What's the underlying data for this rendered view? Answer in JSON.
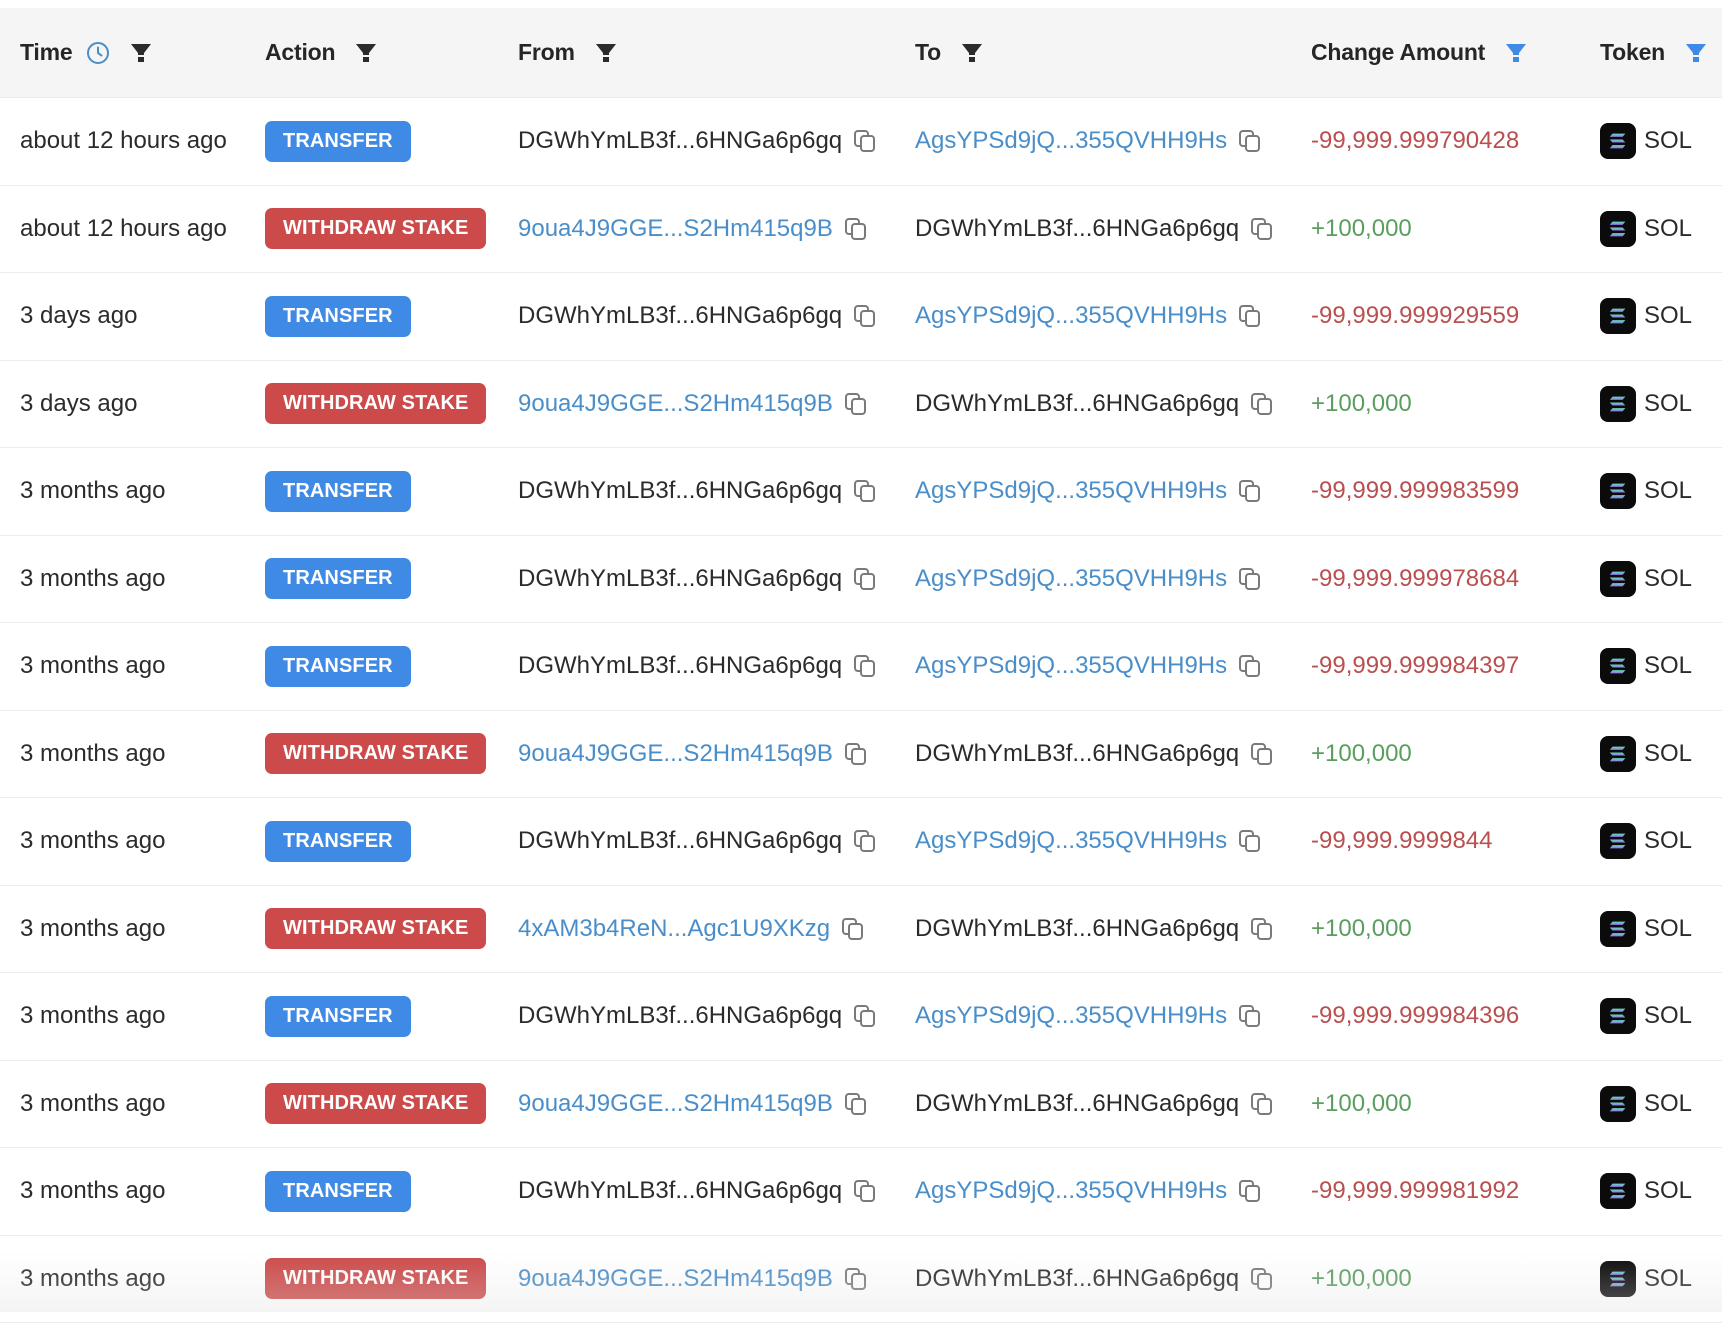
{
  "header": {
    "columns": [
      {
        "label": "Time",
        "icons": [
          "clock-icon",
          "filter-icon"
        ],
        "filter_active": false
      },
      {
        "label": "Action",
        "icons": [
          "filter-icon"
        ],
        "filter_active": false
      },
      {
        "label": "From",
        "icons": [
          "filter-icon"
        ],
        "filter_active": false
      },
      {
        "label": "To",
        "icons": [
          "filter-icon"
        ],
        "filter_active": false
      },
      {
        "label": "Change Amount",
        "icons": [
          "filter-icon"
        ],
        "filter_active": true
      },
      {
        "label": "Token",
        "icons": [
          "filter-icon"
        ],
        "filter_active": true
      }
    ]
  },
  "colors": {
    "transfer_badge": "#3f8ae5",
    "withdraw_badge": "#cc4a4a",
    "link": "#4a8ec9",
    "negative": "#b94f4f",
    "positive": "#5a9e5e",
    "filter_inactive": "#2b2b2b",
    "filter_active": "#3f8ae5",
    "clock": "#4a8ec9"
  },
  "rows": [
    {
      "time": "about 12 hours ago",
      "action": "TRANSFER",
      "action_type": "transfer",
      "from": "DGWhYmLB3f...6HNGa6p6gq",
      "from_link": false,
      "to": "AgsYPSd9jQ...355QVHH9Hs",
      "to_link": true,
      "amount": "-99,999.999790428",
      "amount_sign": "neg",
      "token": "SOL"
    },
    {
      "time": "about 12 hours ago",
      "action": "WITHDRAW STAKE",
      "action_type": "withdraw",
      "from": "9oua4J9GGE...S2Hm415q9B",
      "from_link": true,
      "to": "DGWhYmLB3f...6HNGa6p6gq",
      "to_link": false,
      "amount": "+100,000",
      "amount_sign": "pos",
      "token": "SOL"
    },
    {
      "time": "3 days ago",
      "action": "TRANSFER",
      "action_type": "transfer",
      "from": "DGWhYmLB3f...6HNGa6p6gq",
      "from_link": false,
      "to": "AgsYPSd9jQ...355QVHH9Hs",
      "to_link": true,
      "amount": "-99,999.999929559",
      "amount_sign": "neg",
      "token": "SOL"
    },
    {
      "time": "3 days ago",
      "action": "WITHDRAW STAKE",
      "action_type": "withdraw",
      "from": "9oua4J9GGE...S2Hm415q9B",
      "from_link": true,
      "to": "DGWhYmLB3f...6HNGa6p6gq",
      "to_link": false,
      "amount": "+100,000",
      "amount_sign": "pos",
      "token": "SOL"
    },
    {
      "time": "3 months ago",
      "action": "TRANSFER",
      "action_type": "transfer",
      "from": "DGWhYmLB3f...6HNGa6p6gq",
      "from_link": false,
      "to": "AgsYPSd9jQ...355QVHH9Hs",
      "to_link": true,
      "amount": "-99,999.999983599",
      "amount_sign": "neg",
      "token": "SOL"
    },
    {
      "time": "3 months ago",
      "action": "TRANSFER",
      "action_type": "transfer",
      "from": "DGWhYmLB3f...6HNGa6p6gq",
      "from_link": false,
      "to": "AgsYPSd9jQ...355QVHH9Hs",
      "to_link": true,
      "amount": "-99,999.999978684",
      "amount_sign": "neg",
      "token": "SOL"
    },
    {
      "time": "3 months ago",
      "action": "TRANSFER",
      "action_type": "transfer",
      "from": "DGWhYmLB3f...6HNGa6p6gq",
      "from_link": false,
      "to": "AgsYPSd9jQ...355QVHH9Hs",
      "to_link": true,
      "amount": "-99,999.999984397",
      "amount_sign": "neg",
      "token": "SOL"
    },
    {
      "time": "3 months ago",
      "action": "WITHDRAW STAKE",
      "action_type": "withdraw",
      "from": "9oua4J9GGE...S2Hm415q9B",
      "from_link": true,
      "to": "DGWhYmLB3f...6HNGa6p6gq",
      "to_link": false,
      "amount": "+100,000",
      "amount_sign": "pos",
      "token": "SOL"
    },
    {
      "time": "3 months ago",
      "action": "TRANSFER",
      "action_type": "transfer",
      "from": "DGWhYmLB3f...6HNGa6p6gq",
      "from_link": false,
      "to": "AgsYPSd9jQ...355QVHH9Hs",
      "to_link": true,
      "amount": "-99,999.9999844",
      "amount_sign": "neg",
      "token": "SOL"
    },
    {
      "time": "3 months ago",
      "action": "WITHDRAW STAKE",
      "action_type": "withdraw",
      "from": "4xAM3b4ReN...Agc1U9XKzg",
      "from_link": true,
      "to": "DGWhYmLB3f...6HNGa6p6gq",
      "to_link": false,
      "amount": "+100,000",
      "amount_sign": "pos",
      "token": "SOL"
    },
    {
      "time": "3 months ago",
      "action": "TRANSFER",
      "action_type": "transfer",
      "from": "DGWhYmLB3f...6HNGa6p6gq",
      "from_link": false,
      "to": "AgsYPSd9jQ...355QVHH9Hs",
      "to_link": true,
      "amount": "-99,999.999984396",
      "amount_sign": "neg",
      "token": "SOL"
    },
    {
      "time": "3 months ago",
      "action": "WITHDRAW STAKE",
      "action_type": "withdraw",
      "from": "9oua4J9GGE...S2Hm415q9B",
      "from_link": true,
      "to": "DGWhYmLB3f...6HNGa6p6gq",
      "to_link": false,
      "amount": "+100,000",
      "amount_sign": "pos",
      "token": "SOL"
    },
    {
      "time": "3 months ago",
      "action": "TRANSFER",
      "action_type": "transfer",
      "from": "DGWhYmLB3f...6HNGa6p6gq",
      "from_link": false,
      "to": "AgsYPSd9jQ...355QVHH9Hs",
      "to_link": true,
      "amount": "-99,999.999981992",
      "amount_sign": "neg",
      "token": "SOL"
    },
    {
      "time": "3 months ago",
      "action": "WITHDRAW STAKE",
      "action_type": "withdraw",
      "from": "9oua4J9GGE...S2Hm415q9B",
      "from_link": true,
      "to": "DGWhYmLB3f...6HNGa6p6gq",
      "to_link": false,
      "amount": "+100,000",
      "amount_sign": "pos",
      "token": "SOL"
    }
  ]
}
